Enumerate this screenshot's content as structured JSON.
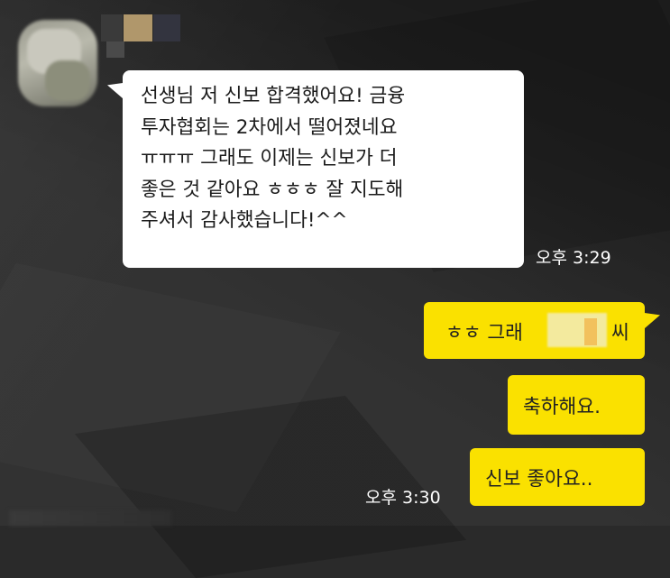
{
  "chat": {
    "incoming": {
      "lines": [
        "선생님 저 신보 합격했어요! 금융",
        "투자협회는 2차에서 떨어졌네요",
        "ㅠㅠㅠ 그래도 이제는 신보가 더",
        "좋은 것 같아요 ㅎㅎㅎ 잘 지도해",
        "주셔서 감사했습니다!^^"
      ],
      "time": "오후 3:29"
    },
    "outgoing": [
      {
        "text_before": "ㅎㅎ 그래",
        "text_after": "씨"
      },
      {
        "text": "축하해요."
      },
      {
        "text": "신보 좋아요.."
      }
    ],
    "outgoing_time": "오후 3:30"
  },
  "colors": {
    "background": "#2b2b2b",
    "incoming_bubble": "#ffffff",
    "outgoing_bubble": "#fae100",
    "timestamp": "#ffffff"
  }
}
